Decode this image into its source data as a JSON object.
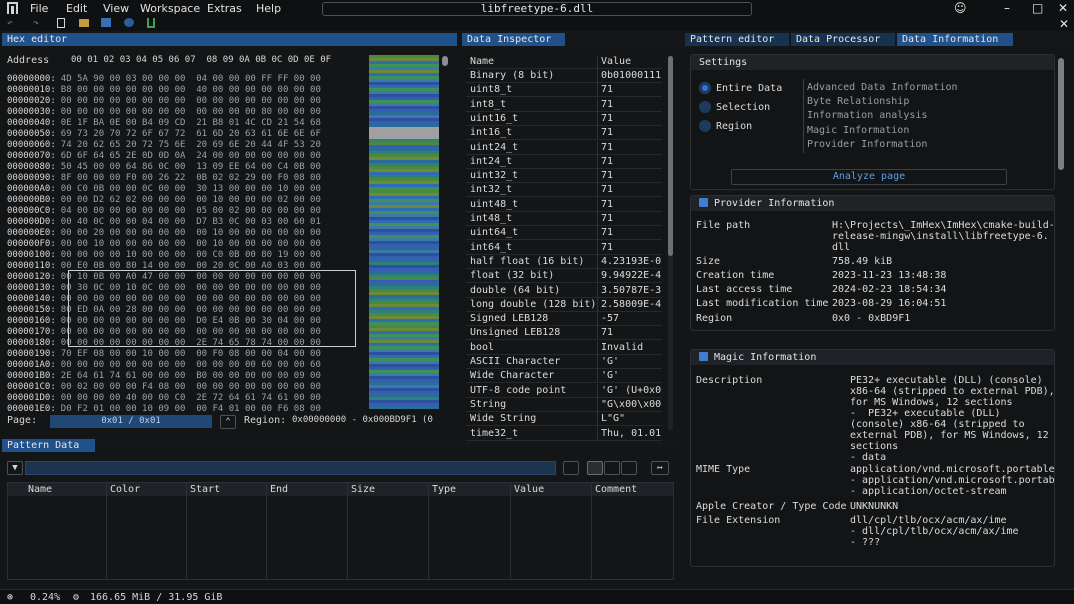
{
  "app": {
    "window_title": "libfreetype-6.dll"
  },
  "menu": [
    "File",
    "Edit",
    "View",
    "Workspace",
    "Extras",
    "Help"
  ],
  "hex_editor": {
    "tab": "Hex editor",
    "address_header": "Address",
    "columns": "00 01 02 03 04 05 06 07  08 09 0A 0B 0C 0D 0E 0F",
    "rows": [
      {
        "addr": "00000000:",
        "bytes": "4D 5A 90 00 03 00 00 00  04 00 00 00 FF FF 00 00"
      },
      {
        "addr": "00000010:",
        "bytes": "B8 00 00 00 00 00 00 00  40 00 00 00 00 00 00 00"
      },
      {
        "addr": "00000020:",
        "bytes": "00 00 00 00 00 00 00 00  00 00 00 00 00 00 00 00"
      },
      {
        "addr": "00000030:",
        "bytes": "00 00 00 00 00 00 00 00  00 00 00 00 80 00 00 00"
      },
      {
        "addr": "00000040:",
        "bytes": "0E 1F BA 0E 00 B4 09 CD  21 B8 01 4C CD 21 54 68"
      },
      {
        "addr": "00000050:",
        "bytes": "69 73 20 70 72 6F 67 72  61 6D 20 63 61 6E 6E 6F"
      },
      {
        "addr": "00000060:",
        "bytes": "74 20 62 65 20 72 75 6E  20 69 6E 20 44 4F 53 20"
      },
      {
        "addr": "00000070:",
        "bytes": "6D 6F 64 65 2E 0D 0D 0A  24 00 00 00 00 00 00 00"
      },
      {
        "addr": "00000080:",
        "bytes": "50 45 00 00 64 86 0C 00  13 09 EE 64 00 C4 0B 00"
      },
      {
        "addr": "00000090:",
        "bytes": "8F 00 00 00 F0 00 26 22  0B 02 02 29 00 F0 08 00"
      },
      {
        "addr": "000000A0:",
        "bytes": "00 C0 0B 00 00 0C 00 00  30 13 00 00 00 10 00 00"
      },
      {
        "addr": "000000B0:",
        "bytes": "00 00 D2 62 02 00 00 00  00 10 00 00 00 02 00 00"
      },
      {
        "addr": "000000C0:",
        "bytes": "04 00 00 00 00 00 00 00  05 00 02 00 00 00 00 00"
      },
      {
        "addr": "000000D0:",
        "bytes": "00 40 0C 00 00 04 00 00  D7 B3 0C 00 03 00 60 01"
      },
      {
        "addr": "000000E0:",
        "bytes": "00 00 20 00 00 00 00 00  00 10 00 00 00 00 00 00"
      },
      {
        "addr": "000000F0:",
        "bytes": "00 00 10 00 00 00 00 00  00 10 00 00 00 00 00 00"
      },
      {
        "addr": "00000100:",
        "bytes": "00 00 00 00 10 00 00 00  00 C0 0B 00 80 19 00 00"
      },
      {
        "addr": "00000110:",
        "bytes": "00 E0 0B 00 80 14 00 00  00 20 0C 00 A0 03 00 00"
      },
      {
        "addr": "00000120:",
        "bytes": "00 10 0B 00 A0 47 00 00  00 00 00 00 00 00 00 00"
      },
      {
        "addr": "00000130:",
        "bytes": "00 30 0C 00 10 0C 00 00  00 00 00 00 00 00 00 00"
      },
      {
        "addr": "00000140:",
        "bytes": "00 00 00 00 00 00 00 00  00 00 00 00 00 00 00 00"
      },
      {
        "addr": "00000150:",
        "bytes": "80 ED 0A 00 28 00 00 00  00 00 00 00 00 00 00 00"
      },
      {
        "addr": "00000160:",
        "bytes": "00 00 00 00 00 00 00 00  D0 E4 0B 00 30 04 00 00"
      },
      {
        "addr": "00000170:",
        "bytes": "00 00 00 00 00 00 00 00  00 00 00 00 00 00 00 00"
      },
      {
        "addr": "00000180:",
        "bytes": "00 00 00 00 00 00 00 00  2E 74 65 78 74 00 00 00"
      },
      {
        "addr": "00000190:",
        "bytes": "70 EF 08 00 00 10 00 00  00 F0 08 00 00 04 00 00"
      },
      {
        "addr": "000001A0:",
        "bytes": "00 00 00 00 00 00 00 00  00 00 00 00 60 00 00 60"
      },
      {
        "addr": "000001B0:",
        "bytes": "2E 64 61 74 61 00 00 00  B0 00 00 00 00 00 09 00"
      },
      {
        "addr": "000001C0:",
        "bytes": "00 02 00 00 00 F4 08 00  00 00 00 00 00 00 00 00"
      },
      {
        "addr": "000001D0:",
        "bytes": "00 00 00 00 40 00 00 C0  2E 72 64 61 74 61 00 00"
      },
      {
        "addr": "000001E0:",
        "bytes": "D0 F2 01 00 00 10 09 00  00 F4 01 00 00 F6 08 00"
      }
    ],
    "page_label": "Page:",
    "page_value": "0x01 / 0x01",
    "region_label": "Region:",
    "region_value": "0x00000000 - 0x000BD9F1 (0"
  },
  "data_inspector": {
    "tab": "Data Inspector",
    "col_name": "Name",
    "col_value": "Value",
    "rows": [
      {
        "name": "Binary (8 bit)",
        "value": "0b01000111"
      },
      {
        "name": "uint8_t",
        "value": "71"
      },
      {
        "name": "int8_t",
        "value": "71"
      },
      {
        "name": "uint16_t",
        "value": "71"
      },
      {
        "name": "int16_t",
        "value": "71"
      },
      {
        "name": "uint24_t",
        "value": "71"
      },
      {
        "name": "int24_t",
        "value": "71"
      },
      {
        "name": "uint32_t",
        "value": "71"
      },
      {
        "name": "int32_t",
        "value": "71"
      },
      {
        "name": "uint48_t",
        "value": "71"
      },
      {
        "name": "int48_t",
        "value": "71"
      },
      {
        "name": "uint64_t",
        "value": "71"
      },
      {
        "name": "int64_t",
        "value": "71"
      },
      {
        "name": "half float (16 bit)",
        "value": "4.23193E-0"
      },
      {
        "name": "float (32 bit)",
        "value": "9.94922E-4"
      },
      {
        "name": "double (64 bit)",
        "value": "3.50787E-3"
      },
      {
        "name": "long double (128 bit)",
        "value": "2.58009E-4"
      },
      {
        "name": "Signed LEB128",
        "value": "-57"
      },
      {
        "name": "Unsigned LEB128",
        "value": "71"
      },
      {
        "name": "bool",
        "value": "Invalid"
      },
      {
        "name": "ASCII Character",
        "value": "'G'"
      },
      {
        "name": "Wide Character",
        "value": "'G'"
      },
      {
        "name": "UTF-8 code point",
        "value": "'G' (U+0x0"
      },
      {
        "name": "String",
        "value": "\"G\\x00\\x00"
      },
      {
        "name": "Wide String",
        "value": "L\"G\""
      },
      {
        "name": "time32_t",
        "value": "Thu, 01.01"
      }
    ]
  },
  "right_tabs": [
    "Pattern editor",
    "Data Processor",
    "Data Information"
  ],
  "settings": {
    "title": "Settings",
    "radios": [
      "Entire Data",
      "Selection",
      "Region"
    ],
    "options": [
      "Advanced Data Information",
      "Byte Relationship",
      "Information analysis",
      "Magic Information",
      "Provider Information"
    ],
    "analyze_button": "Analyze page"
  },
  "provider_info": {
    "title": "Provider Information",
    "rows": [
      {
        "k": "File path",
        "v": "H:\\Projects\\_ImHex\\ImHex\\cmake-build-\nrelease-mingw\\install\\libfreetype-6.\ndll"
      },
      {
        "k": "Size",
        "v": "758.49 kiB"
      },
      {
        "k": "Creation time",
        "v": "2023-11-23 13:48:38"
      },
      {
        "k": "Last access time",
        "v": "2024-02-23 18:54:34"
      },
      {
        "k": "Last modification time",
        "v": "2023-08-29 16:04:51"
      },
      {
        "k": "Region",
        "v": "0x0 - 0xBD9F1"
      }
    ]
  },
  "magic_info": {
    "title": "Magic Information",
    "rows": [
      {
        "k": "Description",
        "v": "PE32+ executable (DLL) (console)\nx86-64 (stripped to external PDB),\nfor MS Windows, 12 sections\n-  PE32+ executable (DLL)\n(console) x86-64 (stripped to\nexternal PDB), for MS Windows, 12\nsections\n- data"
      },
      {
        "k": "MIME Type",
        "v": "application/vnd.microsoft.portable\n- application/vnd.microsoft.portab\n- application/octet-stream"
      },
      {
        "k": "Apple Creator / Type Code",
        "v": "UNKNUNKN"
      },
      {
        "k": "File Extension",
        "v": "dll/cpl/tlb/ocx/acm/ax/ime\n- dll/cpl/tlb/ocx/acm/ax/ime\n- ???"
      }
    ]
  },
  "pattern_data": {
    "tab": "Pattern Data",
    "columns": [
      "Name",
      "Color",
      "Start",
      "End",
      "Size",
      "Type",
      "Value",
      "Comment"
    ]
  },
  "status": {
    "cpu": "0.24%",
    "memory": "166.65 MiB / 31.95 GiB"
  },
  "colors": {
    "accent": "#20518a",
    "tab_inactive": "#17324f",
    "background": "#151617"
  },
  "icons": [
    "logo-icon",
    "smiley-icon",
    "minimize-icon",
    "maximize-icon",
    "close-icon",
    "undo-icon",
    "redo-icon",
    "new-file-icon",
    "open-folder-icon",
    "save-icon",
    "save-as-icon",
    "bookmark-icon",
    "filter-icon",
    "settings-icon",
    "cpu-icon"
  ]
}
